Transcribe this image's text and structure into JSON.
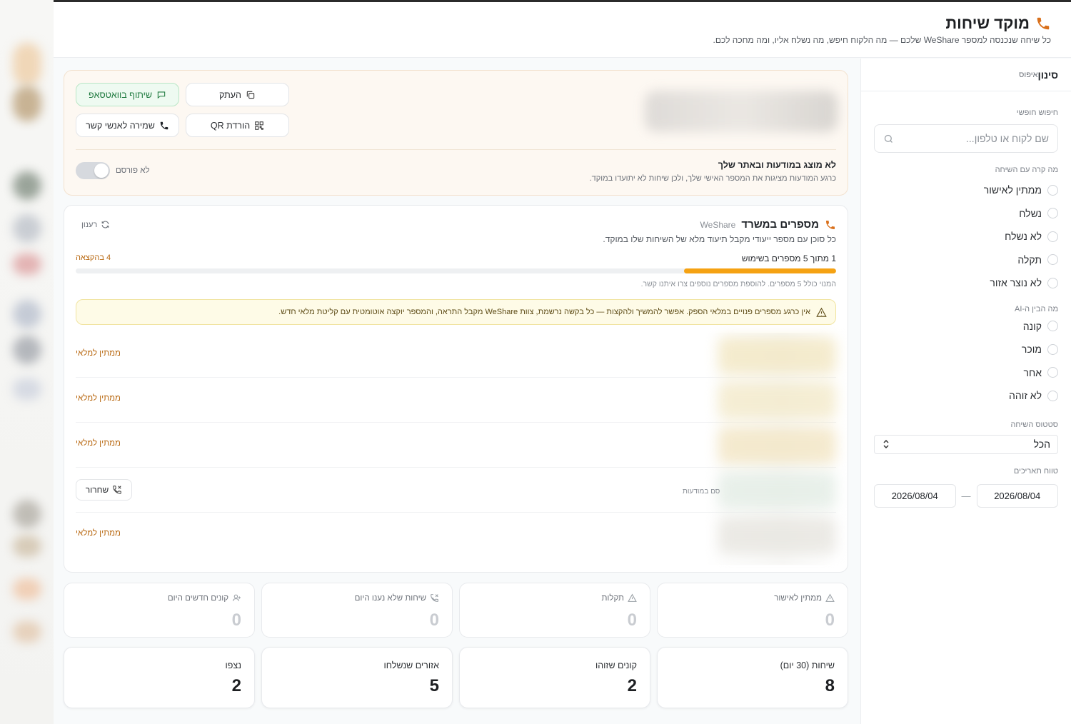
{
  "header": {
    "title": "מוקד שיחות",
    "subtitle": "כל שיחה שנכנסה למספר WeShare שלכם — מה הלקוח חיפש, מה נשלח אליו, ומה מחכה לכם.",
    "icon": "phone-icon"
  },
  "sidebar": {
    "title": "סינון",
    "reset_label": "איפוס",
    "search_label": "חיפוש חופשי",
    "search_placeholder": "שם לקוח או טלפון...",
    "outcome_label": "מה קרה עם השיחה",
    "outcome_options": [
      "ממתין לאישור",
      "נשלח",
      "לא נשלח",
      "תקלה",
      "לא נוצר אזור"
    ],
    "ai_label": "מה הבין ה-AI",
    "ai_options": [
      "קונה",
      "מוכר",
      "אחר",
      "לא זוהה"
    ],
    "status_label": "סטטוס השיחה",
    "status_value": "הכל",
    "dates_label": "טווח תאריכים",
    "date_from": "2026/08/04",
    "date_to": "2026/08/04"
  },
  "publish": {
    "buttons": {
      "copy": "העתק",
      "whatsapp": "שיתוף בוואטסאפ",
      "qr": "הורדת QR",
      "contacts": "שמירה לאנשי קשר"
    },
    "title": "לא מוצג במודעות ובאתר שלך",
    "subtitle": "כרגע המודעות מציגות את המספר האישי שלך, ולכן שיחות לא יתועדו במוקד.",
    "toggle_label": "לא פורסם",
    "toggle_on": false
  },
  "numbers": {
    "title": "מספרים במשרד",
    "brand": "WeShare",
    "subtitle": "כל סוכן עם מספר ייעודי מקבל תיעוד מלא של השיחות שלו במוקד.",
    "refresh_label": "רענון",
    "usage_text": "1 מתוך 5 מספרים בשימוש",
    "allocation_text": "4 בהקצאה",
    "usage_used": 1,
    "usage_total": 5,
    "note": "המנוי כולל 5 מספרים. להוספת מספרים נוספים צרו איתנו קשר.",
    "alert": "אין כרגע מספרים פנויים במלאי הספק. אפשר להמשיך ולהקצות — כל בקשה נרשמת, צוות WeShare מקבל התראה, והמספר יוקצה אוטומטית עם קליטת מלאי חדש.",
    "rows": [
      {
        "status": "ממתין למלאי",
        "type": "waiting"
      },
      {
        "status": "ממתין למלאי",
        "type": "waiting"
      },
      {
        "status": "ממתין למלאי",
        "type": "waiting"
      },
      {
        "status": "שחרור",
        "type": "release",
        "ad_note": "סם במודעות"
      },
      {
        "status": "ממתין למלאי",
        "type": "waiting"
      }
    ]
  },
  "stats_small": [
    {
      "label": "ממתין לאישור",
      "value": "0",
      "icon": "warning-icon"
    },
    {
      "label": "תקלות",
      "value": "0",
      "icon": "warning-icon"
    },
    {
      "label": "שיחות שלא נענו היום",
      "value": "0",
      "icon": "missed-call-icon"
    },
    {
      "label": "קונים חדשים היום",
      "value": "0",
      "icon": "add-user-icon"
    }
  ],
  "stats_big": [
    {
      "label": "שיחות (30 יום)",
      "value": "8"
    },
    {
      "label": "קונים שזוהו",
      "value": "2"
    },
    {
      "label": "אזורים שנשלחו",
      "value": "5"
    },
    {
      "label": "נצפו",
      "value": "2"
    }
  ],
  "colors": {
    "accent": "#d9701c",
    "progress": "#f5a213",
    "whatsapp": "#1f7a3f"
  }
}
